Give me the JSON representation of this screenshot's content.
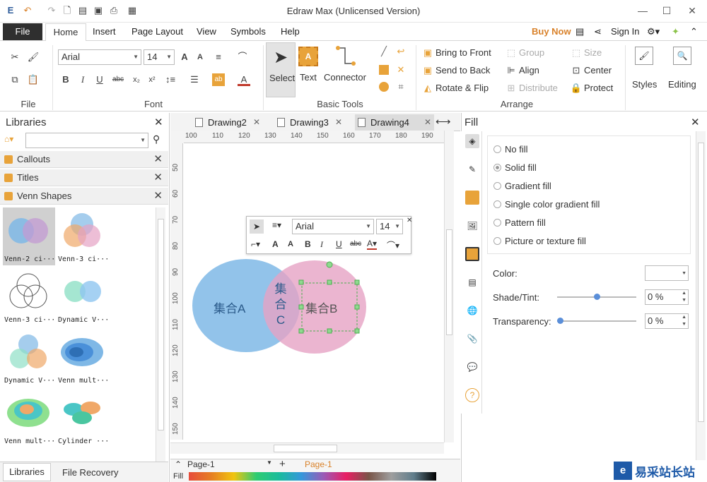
{
  "app": {
    "title": "Edraw Max (Unlicensed Version)"
  },
  "menu": {
    "file": "File",
    "home": "Home",
    "insert": "Insert",
    "page_layout": "Page Layout",
    "view": "View",
    "symbols": "Symbols",
    "help": "Help",
    "buy_now": "Buy Now",
    "sign_in": "Sign In"
  },
  "ribbon": {
    "font": {
      "family": "Arial",
      "size": "14",
      "group_label": "Font"
    },
    "file_group_label": "File",
    "basic_tools": {
      "select": "Select",
      "text": "Text",
      "connector": "Connector",
      "group_label": "Basic Tools"
    },
    "arrange": {
      "bring_to_front": "Bring to Front",
      "send_to_back": "Send to Back",
      "rotate_flip": "Rotate & Flip",
      "group": "Group",
      "align": "Align",
      "distribute": "Distribute",
      "size": "Size",
      "center": "Center",
      "protect": "Protect",
      "group_label": "Arrange"
    },
    "styles": "Styles",
    "editing": "Editing"
  },
  "libraries": {
    "title": "Libraries",
    "sections": [
      "Callouts",
      "Titles",
      "Venn Shapes"
    ],
    "shapes": [
      "Venn-2 ci···",
      "Venn-3 ci···",
      "Venn-3 ci···",
      "Dynamic V···",
      "Dynamic V···",
      "Venn mult···",
      "Venn mult···",
      "Cylinder ···"
    ],
    "bottom_tabs": [
      "Libraries",
      "File Recovery"
    ]
  },
  "tabs": [
    "Drawing2",
    "Drawing3",
    "Drawing4"
  ],
  "ruler": {
    "h": [
      "100",
      "110",
      "120",
      "130",
      "140",
      "150",
      "160",
      "170",
      "180",
      "190"
    ],
    "v": [
      "50",
      "60",
      "70",
      "80",
      "90",
      "100",
      "110",
      "120",
      "130",
      "140",
      "150"
    ]
  },
  "diagram": {
    "set_a": "集合A",
    "set_b": "集合B",
    "set_c": [
      "集",
      "合",
      "C"
    ]
  },
  "mini_toolbar": {
    "font": "Arial",
    "size": "14"
  },
  "pages": {
    "current": "Page-1",
    "tab": "Page-1",
    "fill_label": "Fill"
  },
  "fill_panel": {
    "title": "Fill",
    "options": [
      "No fill",
      "Solid fill",
      "Gradient fill",
      "Single color gradient fill",
      "Pattern fill",
      "Picture or texture fill"
    ],
    "selected": "Solid fill",
    "color_label": "Color:",
    "shade_label": "Shade/Tint:",
    "shade_value": "0 %",
    "transparency_label": "Transparency:",
    "transparency_value": "0 %"
  },
  "watermark": {
    "text": "易采站长站"
  },
  "colors": {
    "accent": "#d9822b",
    "venn_a": "#7fb8e6",
    "venn_b": "#e6a3c4",
    "selection": "#4caf50",
    "file_tab": "#2f2f2f"
  }
}
